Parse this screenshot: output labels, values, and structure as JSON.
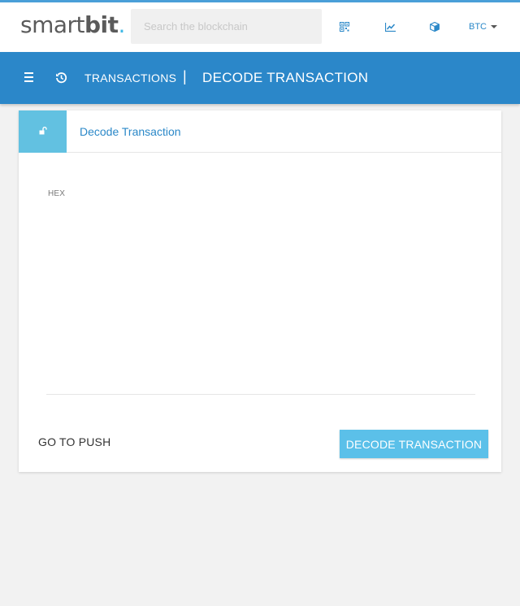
{
  "header": {
    "logo_text": "smart",
    "logo_bold": "bit",
    "logo_dot": ".",
    "search_placeholder": "Search the blockchain",
    "icons": [
      "qr-code-icon",
      "chart-line-icon",
      "cube-icon"
    ],
    "currency": "BTC"
  },
  "nav": {
    "menu_icon": "bars-icon",
    "history_icon": "history-icon",
    "breadcrumb_parent": "TRANSACTIONS",
    "separator": "|",
    "breadcrumb_current": "DECODE TRANSACTION"
  },
  "card": {
    "icon": "unlock-icon",
    "title": "Decode Transaction",
    "hex_label": "HEX",
    "hex_value": "",
    "push_button": "GO TO PUSH",
    "decode_button": "DECODE TRANSACTION"
  },
  "colors": {
    "nav_blue": "#2b87c9",
    "accent_light_blue": "#62c1e1",
    "button_blue": "#5bc0e9",
    "link_blue": "#2b88c8"
  }
}
